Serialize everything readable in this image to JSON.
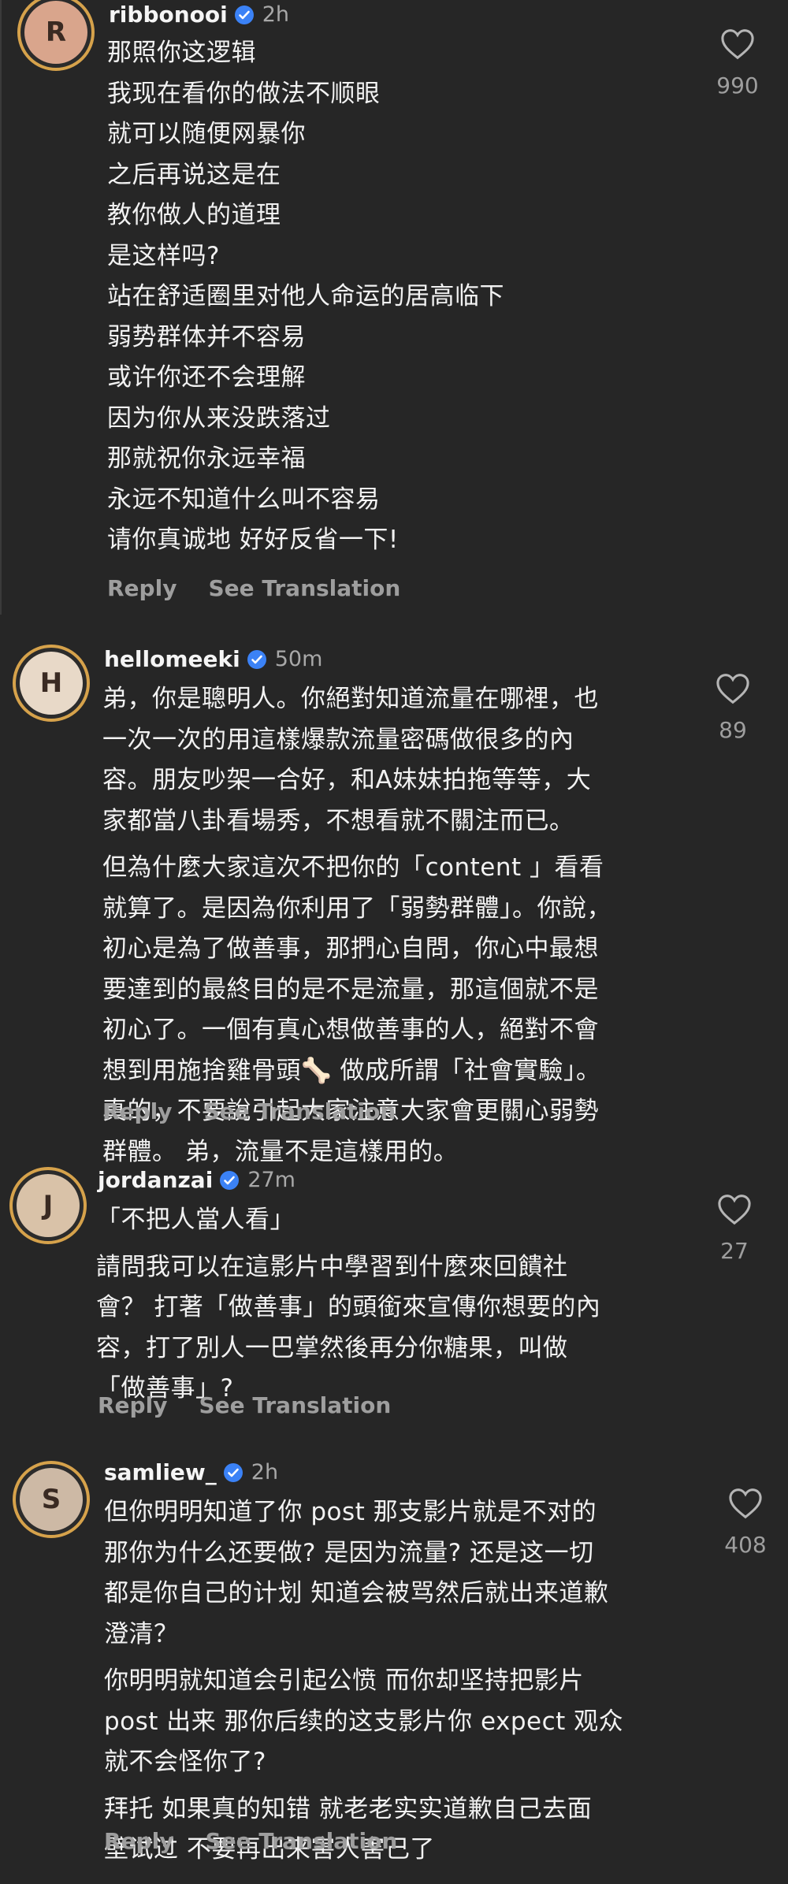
{
  "comments": [
    {
      "username": "ribbonooi",
      "time": "2h",
      "avatar_icon": "woman-portrait",
      "likes": "990",
      "reply_label": "Reply",
      "translate_label": "See Translation",
      "paragraphs": [
        [
          "那照你这逻辑",
          "我现在看你的做法不顺眼",
          "就可以随便网暴你",
          "之后再说这是在",
          "教你做人的道理",
          "是这样吗?",
          "站在舒适圈里对他人命运的居高临下",
          "弱势群体并不容易",
          "或许你还不会理解",
          "因为你从来没跌落过",
          "那就祝你永远幸福",
          "永远不知道什么叫不容易",
          "请你真诚地 好好反省一下!"
        ]
      ]
    },
    {
      "username": "hellomeeki",
      "time": "50m",
      "avatar_icon": "woman-portrait",
      "likes": "89",
      "reply_label": "Reply",
      "translate_label": "See Translation",
      "paragraphs": [
        [
          "弟，你是聰明人。你絕對知道流量在哪裡，也",
          "一次一次的用這樣爆款流量密碼做很多的內",
          "容。朋友吵架一合好，和A妹妹拍拖等等，大",
          "家都當八卦看場秀，不想看就不關注而已。"
        ],
        [
          "但為什麼大家這次不把你的「content 」看看",
          "就算了。是因為你利用了「弱勢群體」。你說，",
          "初心是為了做善事，那捫心自問，你心中最想",
          "要達到的最終目的是不是流量，那這個就不是",
          "初心了。一個有真心想做善事的人，絕對不會",
          "想到用施捨雞骨頭🦴 做成所謂「社會實驗」。",
          "真的，不要說引起大家注意大家會更關心弱勢",
          "群體。 弟，流量不是這樣用的。"
        ]
      ]
    },
    {
      "username": "jordanzai",
      "time": "27m",
      "avatar_icon": "man-portrait",
      "likes": "27",
      "reply_label": "Reply",
      "translate_label": "See Translation",
      "paragraphs": [
        [
          "「不把人當人看」"
        ],
        [
          "請問我可以在這影片中學習到什麼來回饋社",
          "會？ 打著「做善事」的頭銜來宣傳你想要的內",
          "容，打了別人一巴掌然後再分你糖果，叫做",
          "「做善事」?"
        ]
      ]
    },
    {
      "username": "samliew_",
      "time": "2h",
      "avatar_icon": "man-portrait",
      "likes": "408",
      "reply_label": "Reply",
      "translate_label": "See Translation",
      "paragraphs": [
        [
          "但你明明知道了你 post 那支影片就是不对的",
          "那你为什么还要做? 是因为流量? 还是这一切",
          "都是你自己的计划 知道会被骂然后就出来道歉",
          "澄清？"
        ],
        [
          "你明明就知道会引起公愤 而你却坚持把影片",
          "post 出来 那你后续的这支影片你 expect 观众",
          "就不会怪你了?"
        ],
        [
          "拜托 如果真的知错 就老老实实道歉自己去面",
          "壁试过 不要再出来害人害己了"
        ]
      ]
    }
  ],
  "colors": {
    "background": "#262626",
    "text": "#f2f2f2",
    "muted": "#9e9e9e",
    "verified": "#3b82f6",
    "avatar_ring": "#d6a24b"
  }
}
